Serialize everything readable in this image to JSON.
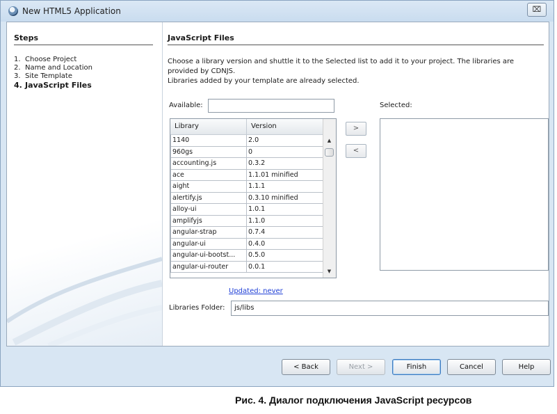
{
  "window": {
    "title": "New HTML5 Application",
    "close_glyph": "⌧"
  },
  "steps": {
    "heading": "Steps",
    "items": [
      {
        "num": "1.",
        "label": "Choose Project"
      },
      {
        "num": "2.",
        "label": "Name and Location"
      },
      {
        "num": "3.",
        "label": "Site Template"
      },
      {
        "num": "4.",
        "label": "JavaScript Files",
        "current": true
      }
    ]
  },
  "main": {
    "heading": "JavaScript Files",
    "description_1": "Choose a library version and shuttle it to the Selected list to add it to your project. The libraries are provided by CDNJS.",
    "description_2": "Libraries added by your template are already selected.",
    "available_label": "Available:",
    "available_value": "",
    "selected_label": "Selected:",
    "columns": [
      "Library",
      "Version"
    ],
    "libraries": [
      {
        "name": "1140",
        "version": "2.0"
      },
      {
        "name": "960gs",
        "version": "0"
      },
      {
        "name": "accounting.js",
        "version": "0.3.2"
      },
      {
        "name": "ace",
        "version": "1.1.01 minified"
      },
      {
        "name": "aight",
        "version": "1.1.1"
      },
      {
        "name": "alertify.js",
        "version": "0.3.10 minified"
      },
      {
        "name": "alloy-ui",
        "version": "1.0.1"
      },
      {
        "name": "amplifyjs",
        "version": "1.1.0"
      },
      {
        "name": "angular-strap",
        "version": "0.7.4"
      },
      {
        "name": "angular-ui",
        "version": "0.4.0"
      },
      {
        "name": "angular-ui-bootst...",
        "version": "0.5.0"
      },
      {
        "name": "angular-ui-router",
        "version": "0.0.1"
      }
    ],
    "add_glyph": ">",
    "remove_glyph": "<",
    "updated_link": "Updated: never",
    "folder_label": "Libraries Folder:",
    "folder_value": "js/libs"
  },
  "footer": {
    "back": "< Back",
    "next": "Next >",
    "finish": "Finish",
    "cancel": "Cancel",
    "help": "Help"
  },
  "caption": "Рис. 4. Диалог подключения JavaScript ресурсов",
  "colors": {
    "frame": "#d8e6f3",
    "link": "#1f3fd6",
    "default_button_border": "#3d7bbf"
  }
}
